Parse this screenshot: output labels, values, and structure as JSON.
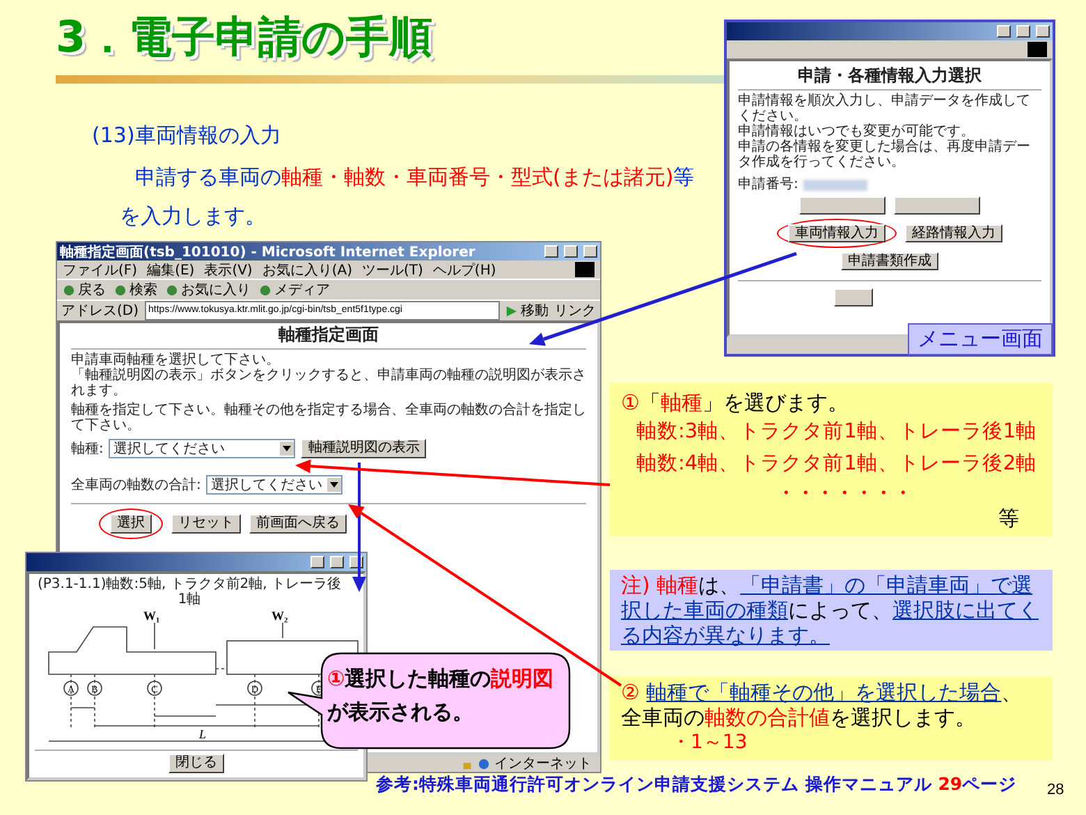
{
  "title": "3．電子申請の手順",
  "section": "(13)車両情報の入力",
  "intro": "申請する車両の**軸種・軸数・車両番号・型式(または諸元)**等を入力します。",
  "menu_window": {
    "heading": "申請・各種情報入力選択",
    "lines": [
      "申請情報を順次入力し、申請データを作成してください。",
      "申請情報はいつでも変更が可能です。",
      "申請の各情報を変更した場合は、再度申請データ作成を行ってください。"
    ],
    "number_label": "申請番号:",
    "button_rows": [
      [
        {
          "circled": false
        },
        {
          "circled": false
        }
      ],
      [
        {
          "label": "車両情報入力",
          "circled": true
        },
        {
          "label": "経路情報入力",
          "circled": false
        }
      ],
      [
        {
          "label": "申請書類作成",
          "circled": false
        }
      ]
    ],
    "footer_buttons": [
      {
        "circled": false
      }
    ],
    "label": "メニュー画面"
  },
  "main_window": {
    "title": "軸種指定画面(tsb_101010) - Microsoft Internet Explorer",
    "menus": [
      "ファイル(F)",
      "編集(E)",
      "表示(V)",
      "お気に入り(A)",
      "ツール(T)",
      "ヘルプ(H)"
    ],
    "toolbar": [
      "戻る",
      "検索",
      "お気に入り",
      "メディア"
    ],
    "address_label": "アドレス(D)",
    "url": "https://www.tokusya.ktr.mlit.go.jp/cgi-bin/tsb_ent5f1type.cgi",
    "go": "移動",
    "links": "リンク",
    "heading": "軸種指定画面",
    "lines": [
      "申請車両軸種を選択して下さい。",
      "「軸種説明図の表示」ボタンをクリックすると、申請車両の軸種の説明図が表示されます。"
    ],
    "note": "軸種を指定して下さい。軸種その他を指定する場合、全車両の軸数の合計を指定して下さい。",
    "axle_type": {
      "label": "軸種:",
      "value": "選択してください",
      "button": "軸種説明図の表示"
    },
    "axle_total": {
      "label": "全車両の軸数の合計:",
      "value": "選択してください"
    },
    "buttons": [
      {
        "label": "選択",
        "circled": true
      },
      {
        "label": "リセット",
        "circled": false
      },
      {
        "label": "前画面へ戻る",
        "circled": false
      }
    ],
    "status": "インターネット"
  },
  "popup": {
    "caption": "(P3.1-1.1)軸数:5軸, トラクタ前2軸, トレーラ後1軸",
    "weights": [
      "W₁",
      "W₂"
    ],
    "axles": [
      "A",
      "B",
      "C",
      "D",
      "E"
    ],
    "length": "L",
    "close": "閉じる"
  },
  "bubble": "**①**選択した軸種の**説明図**が表示される。",
  "select_callout": {
    "heading": "**①**「**軸種**」を選びます。",
    "examples": [
      "軸数:3軸、トラクタ前1軸、トレーラ後1軸",
      "軸数:4軸、トラクタ前1軸、トレーラ後2軸"
    ],
    "ellipsis": "・・・・・・・",
    "etc": "等"
  },
  "note": [
    {
      "kind": "accent",
      "text": "注) 軸種"
    },
    {
      "kind": "plain",
      "text": "は、"
    },
    {
      "kind": "link",
      "text": "「申請書」の「申請車両」で選択した車両の種類"
    },
    {
      "kind": "plain",
      "text": "によって、"
    },
    {
      "kind": "link",
      "text": "選択肢に出てくる内容が異なります。"
    }
  ],
  "total_callout": {
    "text": "**②** *軸種で「軸種その他」を選択した場合*、全車両の**軸数の合計値**を選択します。",
    "range": "・1～13"
  },
  "footer": "参考:特殊車両通行許可オンライン申請支援システム 操作マニュアル **29**ページ",
  "page_number": "28"
}
